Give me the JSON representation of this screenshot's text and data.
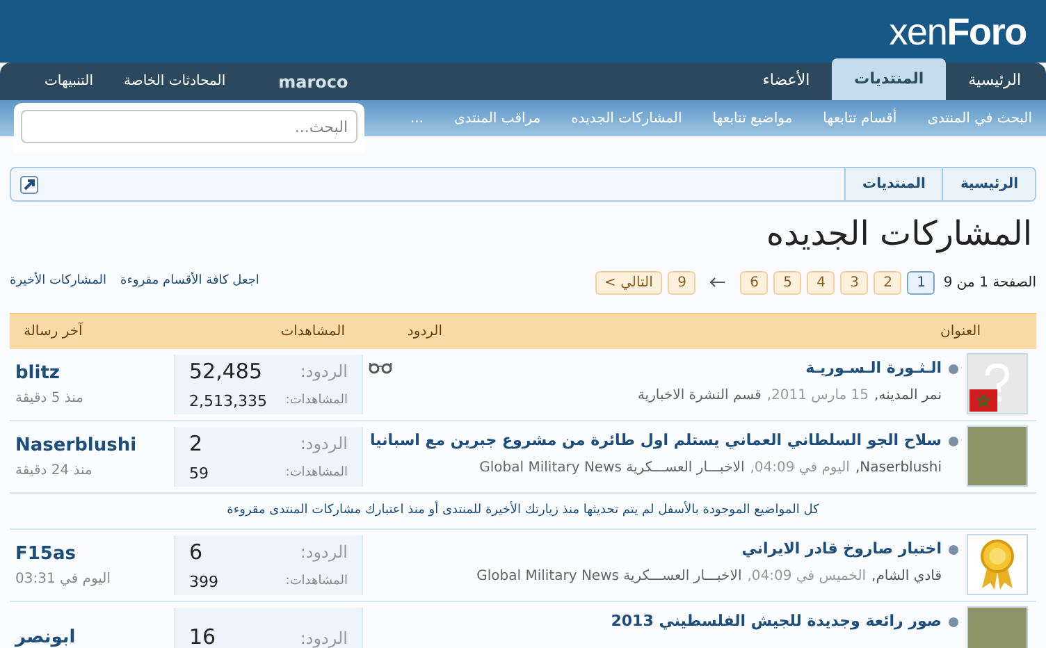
{
  "logo": {
    "part_1": "xen",
    "part_2": "Foro"
  },
  "tabs": [
    {
      "label": "الرئيسية",
      "selected": false
    },
    {
      "label": "المنتديات",
      "selected": true
    },
    {
      "label": "الأعضاء",
      "selected": false
    }
  ],
  "user_links": [
    "maroco",
    "المحادثات الخاصة",
    "التنبيهات"
  ],
  "sub_nav": [
    "البحث في المنتدى",
    "أقسام تتابعها",
    "مواضيع تتابعها",
    "المشاركات الجديده",
    "مراقب المنتدى",
    "..."
  ],
  "search": {
    "placeholder": "البحث..."
  },
  "breadcrumb": [
    "الرئيسية",
    "المنتديات"
  ],
  "page_title": "المشاركات الجديده",
  "pagination": {
    "summary": "الصفحة 1 من 9",
    "pages": [
      {
        "label": "1",
        "selected": true
      },
      {
        "label": "2",
        "selected": false
      },
      {
        "label": "3",
        "selected": false
      },
      {
        "label": "4",
        "selected": false
      },
      {
        "label": "5",
        "selected": false
      },
      {
        "label": "6",
        "selected": false
      }
    ],
    "last": "9",
    "next": "التالي >"
  },
  "actions": [
    "اجعل كافة الأقسام مقروءة",
    "المشاركات الأخيرة"
  ],
  "table": {
    "columns": [
      "العنوان",
      "الردود",
      "المشاهدات",
      "آخر رسالة"
    ],
    "rows": [
      {
        "kind": "thread",
        "avatar": {
          "kind": "placeholder"
        },
        "title": "الـثـورة الـسـوريـة",
        "author": "نمر المدينه,",
        "date": "15 مارس 2011,",
        "forum": "قسم النشرة الاخبارية",
        "watched": true,
        "replies_label": "الردود:",
        "replies": "52,485",
        "views_label": "المشاهدات:",
        "views": "2,513,335",
        "last_poster": "blitz",
        "last_time": "منذ 5 دقيقة"
      },
      {
        "kind": "thread",
        "avatar": {
          "kind": "photo"
        },
        "title": "سلاح الجو السلطاني العماني يستلم اول طائرة من مشروع جبرين مع اسبانيا",
        "author": "Naserblushi,",
        "date": "اليوم في 04:09,",
        "forum": "الاخبـــار العســـكرية Global Military News",
        "watched": false,
        "replies_label": "الردود:",
        "replies": "2",
        "views_label": "المشاهدات:",
        "views": "59",
        "last_poster": "Naserblushi",
        "last_time": "منذ 24 دقيقة"
      },
      {
        "kind": "notice",
        "text": "كل المواضيع الموجودة بالأسفل لم يتم تحديثها منذ زيارتك الأخيرة للمنتدى أو منذ اعتبارك مشاركات المنتدى مقروءة"
      },
      {
        "kind": "thread",
        "avatar": {
          "kind": "medal"
        },
        "title": "اختبار صاروخ قادر الايراني",
        "author": "قادي الشام,",
        "date": "الخميس في 04:09,",
        "forum": "الاخبـــار العســـكرية Global Military News",
        "watched": false,
        "replies_label": "الردود:",
        "replies": "6",
        "views_label": "المشاهدات:",
        "views": "399",
        "last_poster": "F15as",
        "last_time": "اليوم في 03:31"
      },
      {
        "kind": "thread",
        "avatar": {
          "kind": "photo"
        },
        "title": "صور رائعة وجديدة للجيش الفلسطيني 2013",
        "replies_label": "الردود:",
        "replies": "16",
        "last_poster": "ابونصر",
        "watched": false
      }
    ]
  }
}
